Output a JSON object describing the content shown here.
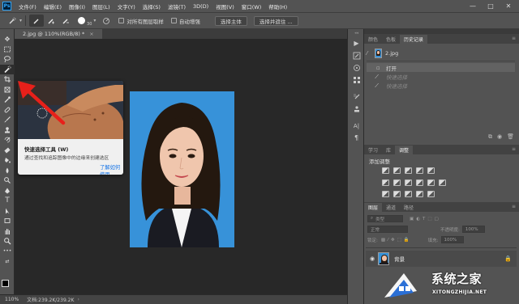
{
  "app": {
    "logo_text": "Ps"
  },
  "menu": [
    "文件(F)",
    "编辑(E)",
    "图像(I)",
    "图层(L)",
    "文字(Y)",
    "选择(S)",
    "滤镜(T)",
    "3D(D)",
    "视图(V)",
    "窗口(W)",
    "帮助(H)"
  ],
  "window_controls": {
    "minimize": "—",
    "maximize": "□",
    "close": "✕"
  },
  "options": {
    "brush_size": "30",
    "sample_all_layers": "对所有图层取样",
    "auto_enhance": "自动增强",
    "select_subject": "选择主体",
    "select_and_mask": "选择并遮住 ..."
  },
  "document": {
    "tab_title": "2.jpg @ 110%(RGB/8) *",
    "close": "×"
  },
  "tooltip": {
    "title": "快速选择工具 (W)",
    "description": "通过查找和追踪图像中的边缘来创建选区",
    "link": "了解如何使用"
  },
  "status": {
    "zoom": "110%",
    "doc_size": "文档:239.2K/239.2K"
  },
  "history_panel": {
    "tabs": [
      "颜色",
      "色板",
      "历史记录"
    ],
    "active_tab": 2,
    "snapshot_name": "2.jpg",
    "items": [
      {
        "label": "打开",
        "dim": false
      },
      {
        "label": "快速选择",
        "dim": true
      },
      {
        "label": "快速选择",
        "dim": true
      }
    ]
  },
  "adjust_panel": {
    "tabs": [
      "学习",
      "库",
      "调整"
    ],
    "active_tab": 2,
    "heading": "添加调整"
  },
  "layers_panel": {
    "tabs": [
      "图层",
      "通道",
      "路径"
    ],
    "active_tab": 0,
    "kind_label": "类型",
    "blend_mode": "正常",
    "opacity_label": "不透明度:",
    "opacity_value": "100%",
    "lock_label": "锁定:",
    "fill_label": "填充:",
    "fill_value": "100%",
    "layer_name": "背景"
  },
  "watermark": {
    "text": "系统之家",
    "url": "XITONGZHIJIA.NET"
  },
  "colors": {
    "photo_bg": "#3792d9",
    "accent_link": "#1473e6",
    "arrow": "#e8201a"
  }
}
